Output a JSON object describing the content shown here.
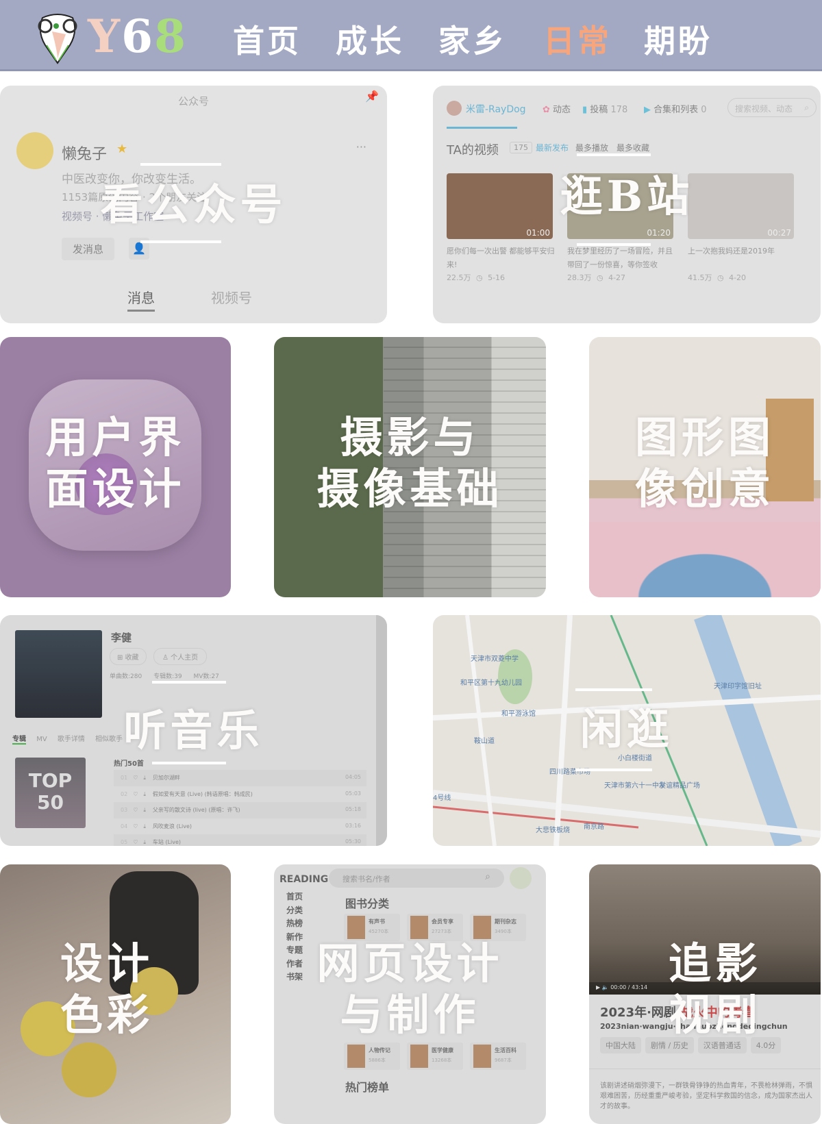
{
  "header": {
    "brand": {
      "y": "Y",
      "six": "6",
      "eight": "8"
    },
    "nav": [
      {
        "label": "首页"
      },
      {
        "label": "成长"
      },
      {
        "label": "家乡"
      },
      {
        "label": "日常",
        "active": true
      },
      {
        "label": "期盼"
      }
    ],
    "colors": {
      "bar": "#a3a8c3",
      "active": "#f7a57c"
    }
  },
  "cards": {
    "wechat": {
      "title": "看公众号",
      "header": "公众号",
      "name": "懒兔子",
      "bio": "中医改变你，你改变生活。",
      "stats": "1153篇原创内容 · 2个朋友关注",
      "channel": "视频号 · 懒兔子工作室",
      "send_btn": "发消息",
      "tabs": [
        "消息",
        "视频号"
      ]
    },
    "bilibili": {
      "title": "逛B站",
      "user": "米雷-RayDog",
      "nav": [
        "动态",
        "投稿",
        "合集和列表"
      ],
      "counts": [
        "178",
        "0"
      ],
      "search_placeholder": "搜索视频、动态",
      "section": "TA的视频",
      "section_count": "175",
      "sorts": [
        "最新发布",
        "最多播放",
        "最多收藏"
      ],
      "videos": [
        {
          "title": "愿你们每一次出警 都能够平安归来!",
          "duration": "01:00",
          "views": "22.5万",
          "date": "5-16"
        },
        {
          "title": "我在梦里经历了一场冒险，并且带回了一份惊喜，等你签收",
          "duration": "01:20",
          "views": "28.3万",
          "date": "4-27"
        },
        {
          "title": "上一次抱我妈还是2019年",
          "duration": "00:27",
          "views": "41.5万",
          "date": "4-20"
        }
      ]
    },
    "ui": {
      "title1": "用户界",
      "title2": "面设计"
    },
    "photo": {
      "title1": "摄影与",
      "title2": "摄像基础"
    },
    "graphic": {
      "title1": "图形图",
      "title2": "像创意"
    },
    "music": {
      "title": "听音乐",
      "artist": "李健",
      "fav": "收藏",
      "home": "个人主页",
      "stats": [
        "单曲数:280",
        "专辑数:39",
        "MV数:27"
      ],
      "tabs": [
        "专辑",
        "MV",
        "歌手详情",
        "相似歌手"
      ],
      "album": "TOP 50",
      "hot": "热门50首",
      "songs": [
        {
          "no": "01",
          "name": "贝加尔湖畔",
          "time": "04:05"
        },
        {
          "no": "02",
          "name": "假如爱有天意 (Live) (韩语原唱：韩成民)",
          "time": "05:03"
        },
        {
          "no": "03",
          "name": "父亲写的散文诗 (live) (原唱：许飞)",
          "time": "05:18"
        },
        {
          "no": "04",
          "name": "风吹麦浪 (Live)",
          "time": "03:16"
        },
        {
          "no": "05",
          "name": "车站 (Live)",
          "time": "05:30"
        }
      ]
    },
    "map": {
      "title": "闲逛",
      "labels": [
        "天津市双菱中学",
        "和平区第十九幼儿园",
        "和平游泳馆",
        "鞍山道",
        "南京路",
        "天津市第六十一中学",
        "小白楼街道",
        "天津印字馆旧址",
        "四川路菜市场",
        "友谊精品广场",
        "大悲铁板烧",
        "4号线"
      ]
    },
    "color": {
      "title1": "设计",
      "title2": "色彩"
    },
    "web": {
      "title1": "网页设计",
      "title2": "与制作",
      "logo": "READING",
      "search_placeholder": "搜索书名/作者",
      "side": [
        "首页",
        "分类",
        "热榜",
        "新作",
        "专题",
        "作者",
        "书架"
      ],
      "section": "图书分类",
      "section2": "热门榜单",
      "books": [
        {
          "name": "有声书",
          "count": "45270本"
        },
        {
          "name": "会员专享",
          "count": "27273本"
        },
        {
          "name": "期刊杂志",
          "count": "3490本"
        },
        {
          "name": "人物传记",
          "count": "5886本"
        },
        {
          "name": "医学健康",
          "count": "13268本"
        },
        {
          "name": "生活百科",
          "count": "9687本"
        }
      ]
    },
    "drama": {
      "title1": "追影",
      "title2": "视剧",
      "show": "2023年·网剧·",
      "show_red": "战火中的青春",
      "pinyin": "2023nian·wangju·zhanhuozhongdeqingchun",
      "tags": [
        "中国大陆",
        "剧情 / 历史",
        "汉语普通话",
        "4.0分"
      ],
      "player_time": "00:00 / 43:14",
      "desc": "该剧讲述硝烟弥漫下，一群铁骨铮铮的热血青年，不畏枪林弹雨，不惧艰难困苦，历经重重严峻考验，坚定科学救国的信念，成为国家杰出人才的故事。"
    }
  }
}
